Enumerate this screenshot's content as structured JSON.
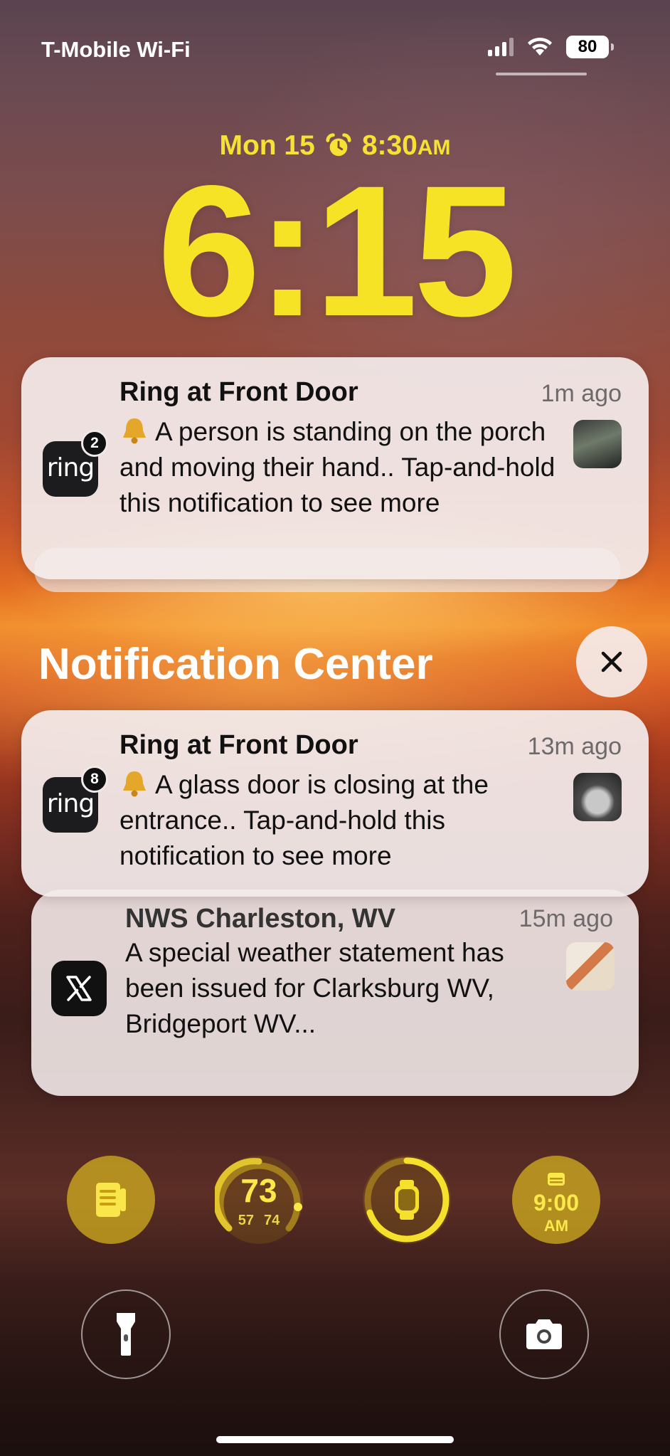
{
  "status_bar": {
    "carrier": "T-Mobile Wi-Fi",
    "battery": "80"
  },
  "lock_screen": {
    "date": "Mon 15",
    "alarm_time": "8:30",
    "alarm_ampm": "AM",
    "time": "6:15"
  },
  "notifications_top": [
    {
      "app": "ring",
      "badge": "2",
      "title": "Ring at Front Door",
      "time": "1m ago",
      "body": "A person is standing on the porch and moving their hand.. Tap-and-hold this notification to see more"
    }
  ],
  "notification_center": {
    "title": "Notification Center",
    "items": [
      {
        "app": "ring",
        "badge": "8",
        "title": "Ring at Front Door",
        "time": "13m ago",
        "body": "A glass door is closing at the entrance.. Tap-and-hold this notification to see more"
      },
      {
        "app": "X",
        "title": "NWS Charleston, WV",
        "time": "15m ago",
        "body": "A special weather statement has been issued for Clarksburg WV, Bridgeport WV..."
      }
    ]
  },
  "widgets": {
    "temperature": "73",
    "temp_low": "57",
    "temp_high": "74",
    "next_alarm_time": "9:00",
    "next_alarm_ampm": "AM",
    "accent_color": "#f7e326"
  },
  "icons": {
    "flashlight": "flashlight-icon",
    "camera": "camera-icon",
    "close": "close-icon"
  }
}
